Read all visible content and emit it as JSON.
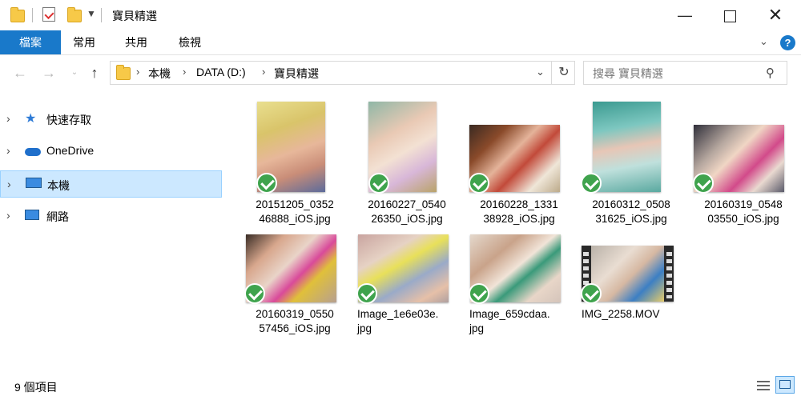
{
  "window": {
    "title": "寶貝精選",
    "minimize_icon": "minimize-icon",
    "maximize_icon": "maximize-icon",
    "close_icon": "close-icon"
  },
  "ribbon": {
    "tabs": [
      {
        "label": "檔案",
        "active": true
      },
      {
        "label": "常用"
      },
      {
        "label": "共用"
      },
      {
        "label": "檢視"
      }
    ],
    "accent": "#1979ca"
  },
  "address": {
    "crumbs": [
      "本機",
      "DATA (D:)",
      "寶貝精選"
    ]
  },
  "search": {
    "placeholder": "搜尋 寶貝精選"
  },
  "nav": {
    "items": [
      {
        "label": "快速存取",
        "icon": "star-icon"
      },
      {
        "label": "OneDrive",
        "icon": "cloud-icon"
      },
      {
        "label": "本機",
        "icon": "monitor-icon",
        "selected": true
      },
      {
        "label": "網路",
        "icon": "network-icon"
      }
    ]
  },
  "files": [
    {
      "name": "20151205_035246888_iOS.jpg",
      "line1": "20151205_0352",
      "line2": "46888_iOS.jpg",
      "synced": true
    },
    {
      "name": "20160227_054026350_iOS.jpg",
      "line1": "20160227_0540",
      "line2": "26350_iOS.jpg",
      "synced": true
    },
    {
      "name": "20160228_133138928_iOS.jpg",
      "line1": "20160228_1331",
      "line2": "38928_iOS.jpg",
      "synced": true
    },
    {
      "name": "20160312_050831625_iOS.jpg",
      "line1": "20160312_0508",
      "line2": "31625_iOS.jpg",
      "synced": true
    },
    {
      "name": "20160319_054803550_iOS.jpg",
      "line1": "20160319_0548",
      "line2": "03550_iOS.jpg",
      "synced": true
    },
    {
      "name": "20160319_055057456_iOS.jpg",
      "line1": "20160319_0550",
      "line2": "57456_iOS.jpg",
      "synced": true
    },
    {
      "name": "Image_1e6e03e.jpg",
      "line1": "Image_1e6e03e.",
      "line2": "jpg",
      "synced": true
    },
    {
      "name": "Image_659cdaa.jpg",
      "line1": "Image_659cdaa.",
      "line2": "jpg",
      "synced": true
    },
    {
      "name": "IMG_2258.MOV",
      "line1": "IMG_2258.MOV",
      "line2": "",
      "synced": true
    }
  ],
  "status": {
    "count_text": "9 個項目"
  }
}
